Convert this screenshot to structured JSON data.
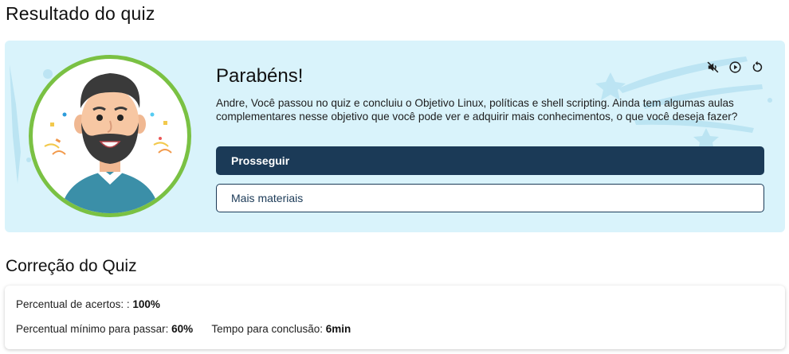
{
  "page_title": "Resultado do quiz",
  "result": {
    "heading": "Parabéns!",
    "message": "Andre, Você passou no quiz e concluiu o Objetivo Linux, políticas e shell scripting. Ainda tem algumas aulas complementares nesse objetivo que você pode ver e adquirir mais conhecimentos, o que você deseja fazer?",
    "primary_button": "Prosseguir",
    "secondary_button": "Mais materiais",
    "controls": [
      {
        "icon": "mute-icon"
      },
      {
        "icon": "play-circle-icon"
      },
      {
        "icon": "replay-icon"
      }
    ]
  },
  "correction": {
    "title": "Correção do Quiz",
    "score_label": "Percentual de acertos: :",
    "score_value": "100%",
    "min_label": "Percentual mínimo para passar:",
    "min_value": "60%",
    "time_label": "Tempo para conclusão:",
    "time_value": "6min"
  },
  "colors": {
    "card_bg": "#d9f3fb",
    "primary": "#1b3a57",
    "ring": "#7ac143"
  }
}
